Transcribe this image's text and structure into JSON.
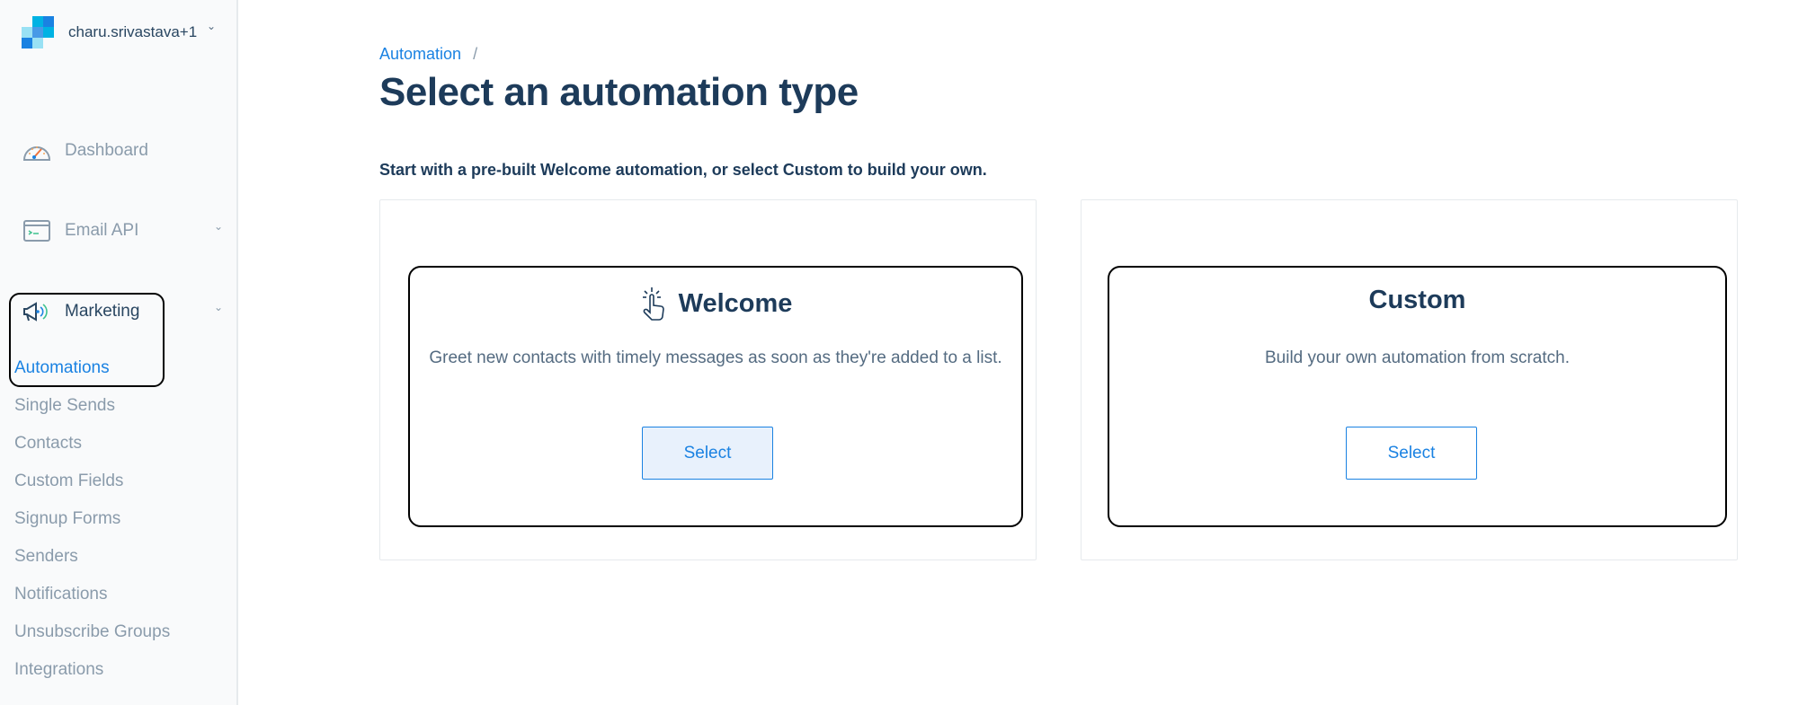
{
  "account": {
    "name": "charu.srivastava+1",
    "logo_colors": [
      "#1a82e2",
      "#00b2e3",
      "#99e1f4"
    ]
  },
  "sidebar": {
    "nav_items": [
      {
        "label": "Dashboard",
        "icon": "speedometer-icon",
        "has_chevron": false
      },
      {
        "label": "Email API",
        "icon": "terminal-window-icon",
        "has_chevron": true
      },
      {
        "label": "Marketing",
        "icon": "megaphone-icon",
        "has_chevron": true,
        "expanded": true
      }
    ],
    "marketing_sub_items": [
      {
        "label": "Automations",
        "active": true
      },
      {
        "label": "Single Sends"
      },
      {
        "label": "Contacts"
      },
      {
        "label": "Custom Fields"
      },
      {
        "label": "Signup Forms"
      },
      {
        "label": "Senders"
      },
      {
        "label": "Notifications"
      },
      {
        "label": "Unsubscribe Groups"
      },
      {
        "label": "Integrations"
      }
    ]
  },
  "breadcrumb": {
    "items": [
      {
        "label": "Automation"
      }
    ],
    "separator": "/"
  },
  "page": {
    "title": "Select an automation type",
    "subtitle": "Start with a pre-built Welcome automation, or select Custom to build your own."
  },
  "cards": [
    {
      "title": "Welcome",
      "icon": "pointer-click-icon",
      "description": "Greet new contacts with timely messages as soon as they're added to a list.",
      "button_label": "Select",
      "button_hovered": true
    },
    {
      "title": "Custom",
      "description": "Build your own automation from scratch.",
      "button_label": "Select",
      "button_hovered": false
    }
  ],
  "colors": {
    "accent": "#1a82e2",
    "heading": "#1d3b5a",
    "muted": "#8a9bab"
  }
}
